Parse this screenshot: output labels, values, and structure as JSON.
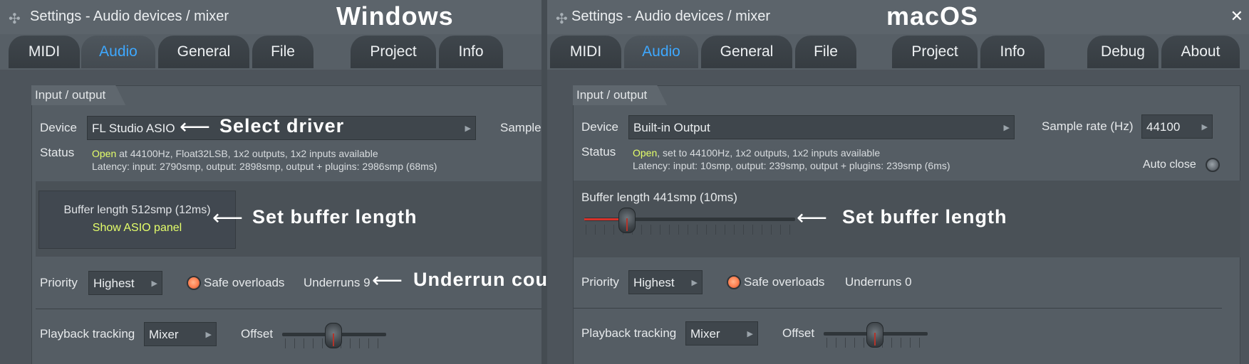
{
  "windows": {
    "window_title": "Settings - Audio devices / mixer",
    "os_label": "Windows",
    "tabs": [
      "MIDI",
      "Audio",
      "General",
      "File",
      "Project",
      "Info"
    ],
    "active_tab": "Audio",
    "group_label": "Input / output",
    "device_label": "Device",
    "device_value": "FL Studio ASIO",
    "sample_label": "Sample",
    "status_label": "Status",
    "status_open": "Open",
    "status_rest": " at 44100Hz, Float32LSB, 1x2 outputs, 1x2 inputs available",
    "latency": "Latency: input: 2790smp, output: 2898smp, output + plugins: 2986smp (68ms)",
    "buffer_length": "Buffer length 512smp (12ms)",
    "show_asio": "Show ASIO panel",
    "priority_label": "Priority",
    "priority_value": "Highest",
    "safe_overloads": "Safe overloads",
    "underruns": "Underruns 9",
    "playback_label": "Playback tracking",
    "playback_value": "Mixer",
    "offset_label": "Offset",
    "annotations": {
      "select_driver": "Select driver",
      "set_buffer": "Set buffer length",
      "underrun_count": "Underrun count"
    }
  },
  "mac": {
    "window_title": "Settings - Audio devices / mixer",
    "os_label": "macOS",
    "close_glyph": "✕",
    "tabs": [
      "MIDI",
      "Audio",
      "General",
      "File",
      "Project",
      "Info",
      "Debug",
      "About"
    ],
    "active_tab": "Audio",
    "group_label": "Input / output",
    "device_label": "Device",
    "device_value": "Built-in Output",
    "sample_rate_label": "Sample rate (Hz)",
    "sample_rate_value": "44100",
    "status_label": "Status",
    "status_open": "Open",
    "status_rest": ", set to 44100Hz, 1x2 outputs, 1x2 inputs available",
    "latency": "Latency: input: 10smp, output: 239smp, output + plugins: 239smp (6ms)",
    "auto_close": "Auto close",
    "buffer_length": "Buffer length 441smp (10ms)",
    "buffer_slider_fraction": 0.2,
    "priority_label": "Priority",
    "priority_value": "Highest",
    "safe_overloads": "Safe overloads",
    "underruns": "Underruns 0",
    "playback_label": "Playback tracking",
    "playback_value": "Mixer",
    "offset_label": "Offset",
    "annotations": {
      "set_buffer": "Set buffer length"
    }
  },
  "icons": {
    "app_icon": "fl-studio-waveform-icon",
    "arrow": "left-arrow-icon",
    "combo_arrow": "triangle-right-icon"
  }
}
